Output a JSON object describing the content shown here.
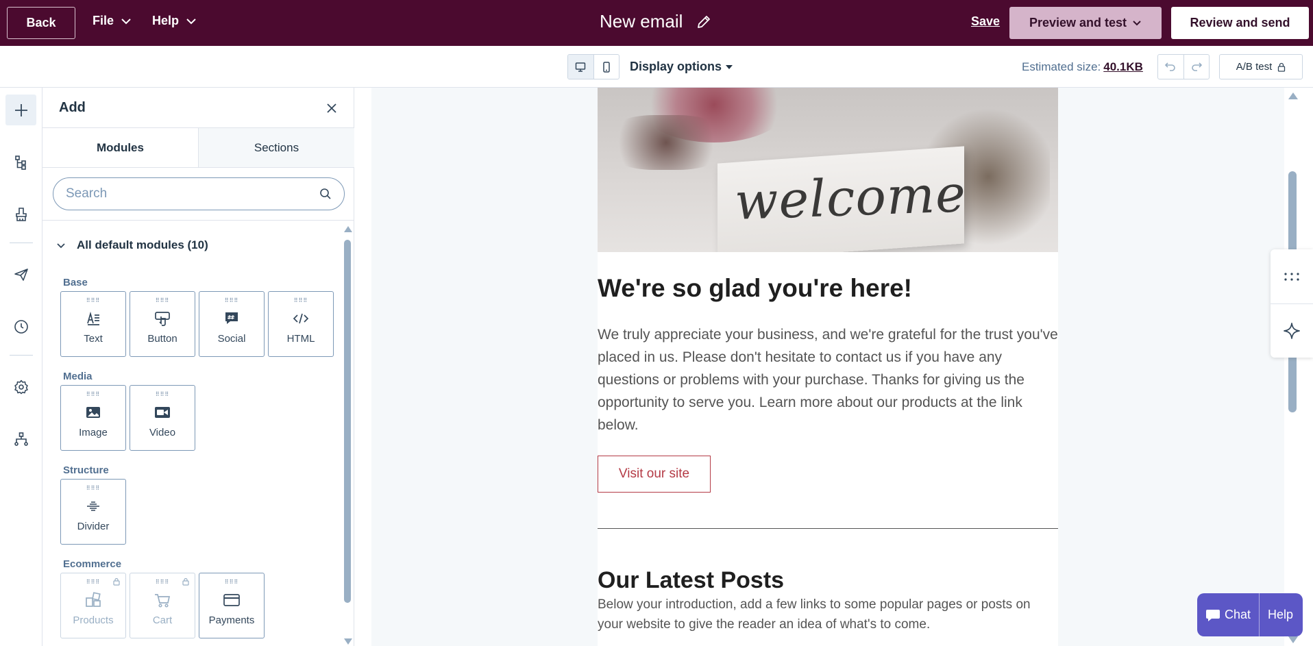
{
  "topbar": {
    "back_label": "Back",
    "file_label": "File",
    "help_label": "Help",
    "email_title": "New email",
    "save_label": "Save",
    "preview_label": "Preview and test",
    "review_label": "Review and send"
  },
  "subbar": {
    "display_options_label": "Display options",
    "estimated_size_label": "Estimated size:",
    "estimated_size_value": "40.1KB",
    "ab_test_label": "A/B test"
  },
  "panel": {
    "title": "Add",
    "tabs": [
      {
        "label": "Modules",
        "active": true
      },
      {
        "label": "Sections",
        "active": false
      }
    ],
    "search_placeholder": "Search",
    "section_title": "All default modules (10)",
    "groups": {
      "base": {
        "label": "Base",
        "modules": [
          {
            "label": "Text",
            "icon": "text-icon"
          },
          {
            "label": "Button",
            "icon": "button-icon"
          },
          {
            "label": "Social",
            "icon": "social-icon"
          },
          {
            "label": "HTML",
            "icon": "html-icon"
          }
        ]
      },
      "media": {
        "label": "Media",
        "modules": [
          {
            "label": "Image",
            "icon": "image-icon"
          },
          {
            "label": "Video",
            "icon": "video-icon"
          }
        ]
      },
      "structure": {
        "label": "Structure",
        "modules": [
          {
            "label": "Divider",
            "icon": "divider-icon"
          }
        ]
      },
      "ecommerce": {
        "label": "Ecommerce",
        "modules": [
          {
            "label": "Products",
            "icon": "products-icon",
            "locked": true
          },
          {
            "label": "Cart",
            "icon": "cart-icon",
            "locked": true
          },
          {
            "label": "Payments",
            "icon": "payments-icon",
            "locked": false
          }
        ]
      }
    }
  },
  "email": {
    "hero_word": "welcome",
    "heading": "We're so glad you're here!",
    "paragraph": "We truly appreciate your business, and we're grateful for the trust you've placed in us. Please don't hesitate to contact us if you have any questions or problems with your purchase. Thanks for giving us the opportunity to serve you. Learn more about our products at the link below.",
    "button_label": "Visit our site",
    "posts_heading": "Our Latest Posts",
    "posts_paragraph": "Below your introduction, add a few links to some popular pages or posts on your website to give the reader an idea of what's to come."
  },
  "chat": {
    "chat_label": "Chat",
    "help_label": "Help"
  },
  "colors": {
    "topbar_bg": "#4b0a2f",
    "preview_bg": "#d5b4ca",
    "accent_red": "#b43a45",
    "chat_bg": "#5c57c6"
  }
}
